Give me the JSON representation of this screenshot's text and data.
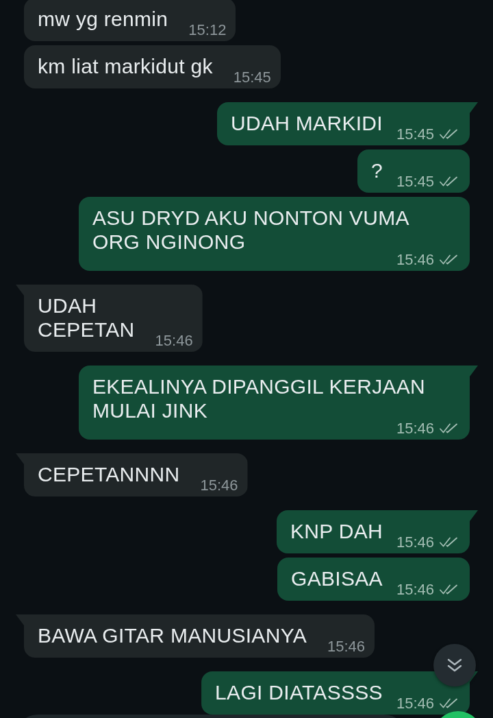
{
  "messages": [
    {
      "kind": "incoming",
      "text": "mw yg renmin",
      "time": "15:12",
      "tail": false
    },
    {
      "kind": "incoming",
      "text": "km liat markidut gk",
      "time": "15:45",
      "tail": false
    },
    {
      "kind": "outgoing",
      "text": "UDAH MARKIDI",
      "time": "15:45",
      "tail": true,
      "read": false
    },
    {
      "kind": "outgoing",
      "text": "?",
      "time": "15:45",
      "tail": false,
      "read": false
    },
    {
      "kind": "outgoing",
      "text": "ASU DRYD AKU NONTON VUMA ORG NGINONG",
      "time": "15:46",
      "tail": false,
      "read": false
    },
    {
      "kind": "incoming",
      "text": "UDAH\nCEPETAN",
      "time": "15:46",
      "tail": true
    },
    {
      "kind": "outgoing",
      "text": "EKEALINYA DIPANGGIL KERJAAN MULAI JINK",
      "time": "15:46",
      "tail": true,
      "read": false
    },
    {
      "kind": "incoming",
      "text": "CEPETANNNN",
      "time": "15:46",
      "tail": true
    },
    {
      "kind": "outgoing",
      "text": "KNP DAH",
      "time": "15:46",
      "tail": true,
      "read": false
    },
    {
      "kind": "outgoing",
      "text": "GABISAA",
      "time": "15:46",
      "tail": false,
      "read": false
    },
    {
      "kind": "incoming",
      "text": "BAWA GITAR MANUSIANYA",
      "time": "15:46",
      "tail": true
    },
    {
      "kind": "outgoing",
      "text": "LAGI DIATASSSS",
      "time": "15:46",
      "tail": true,
      "read": false
    }
  ]
}
